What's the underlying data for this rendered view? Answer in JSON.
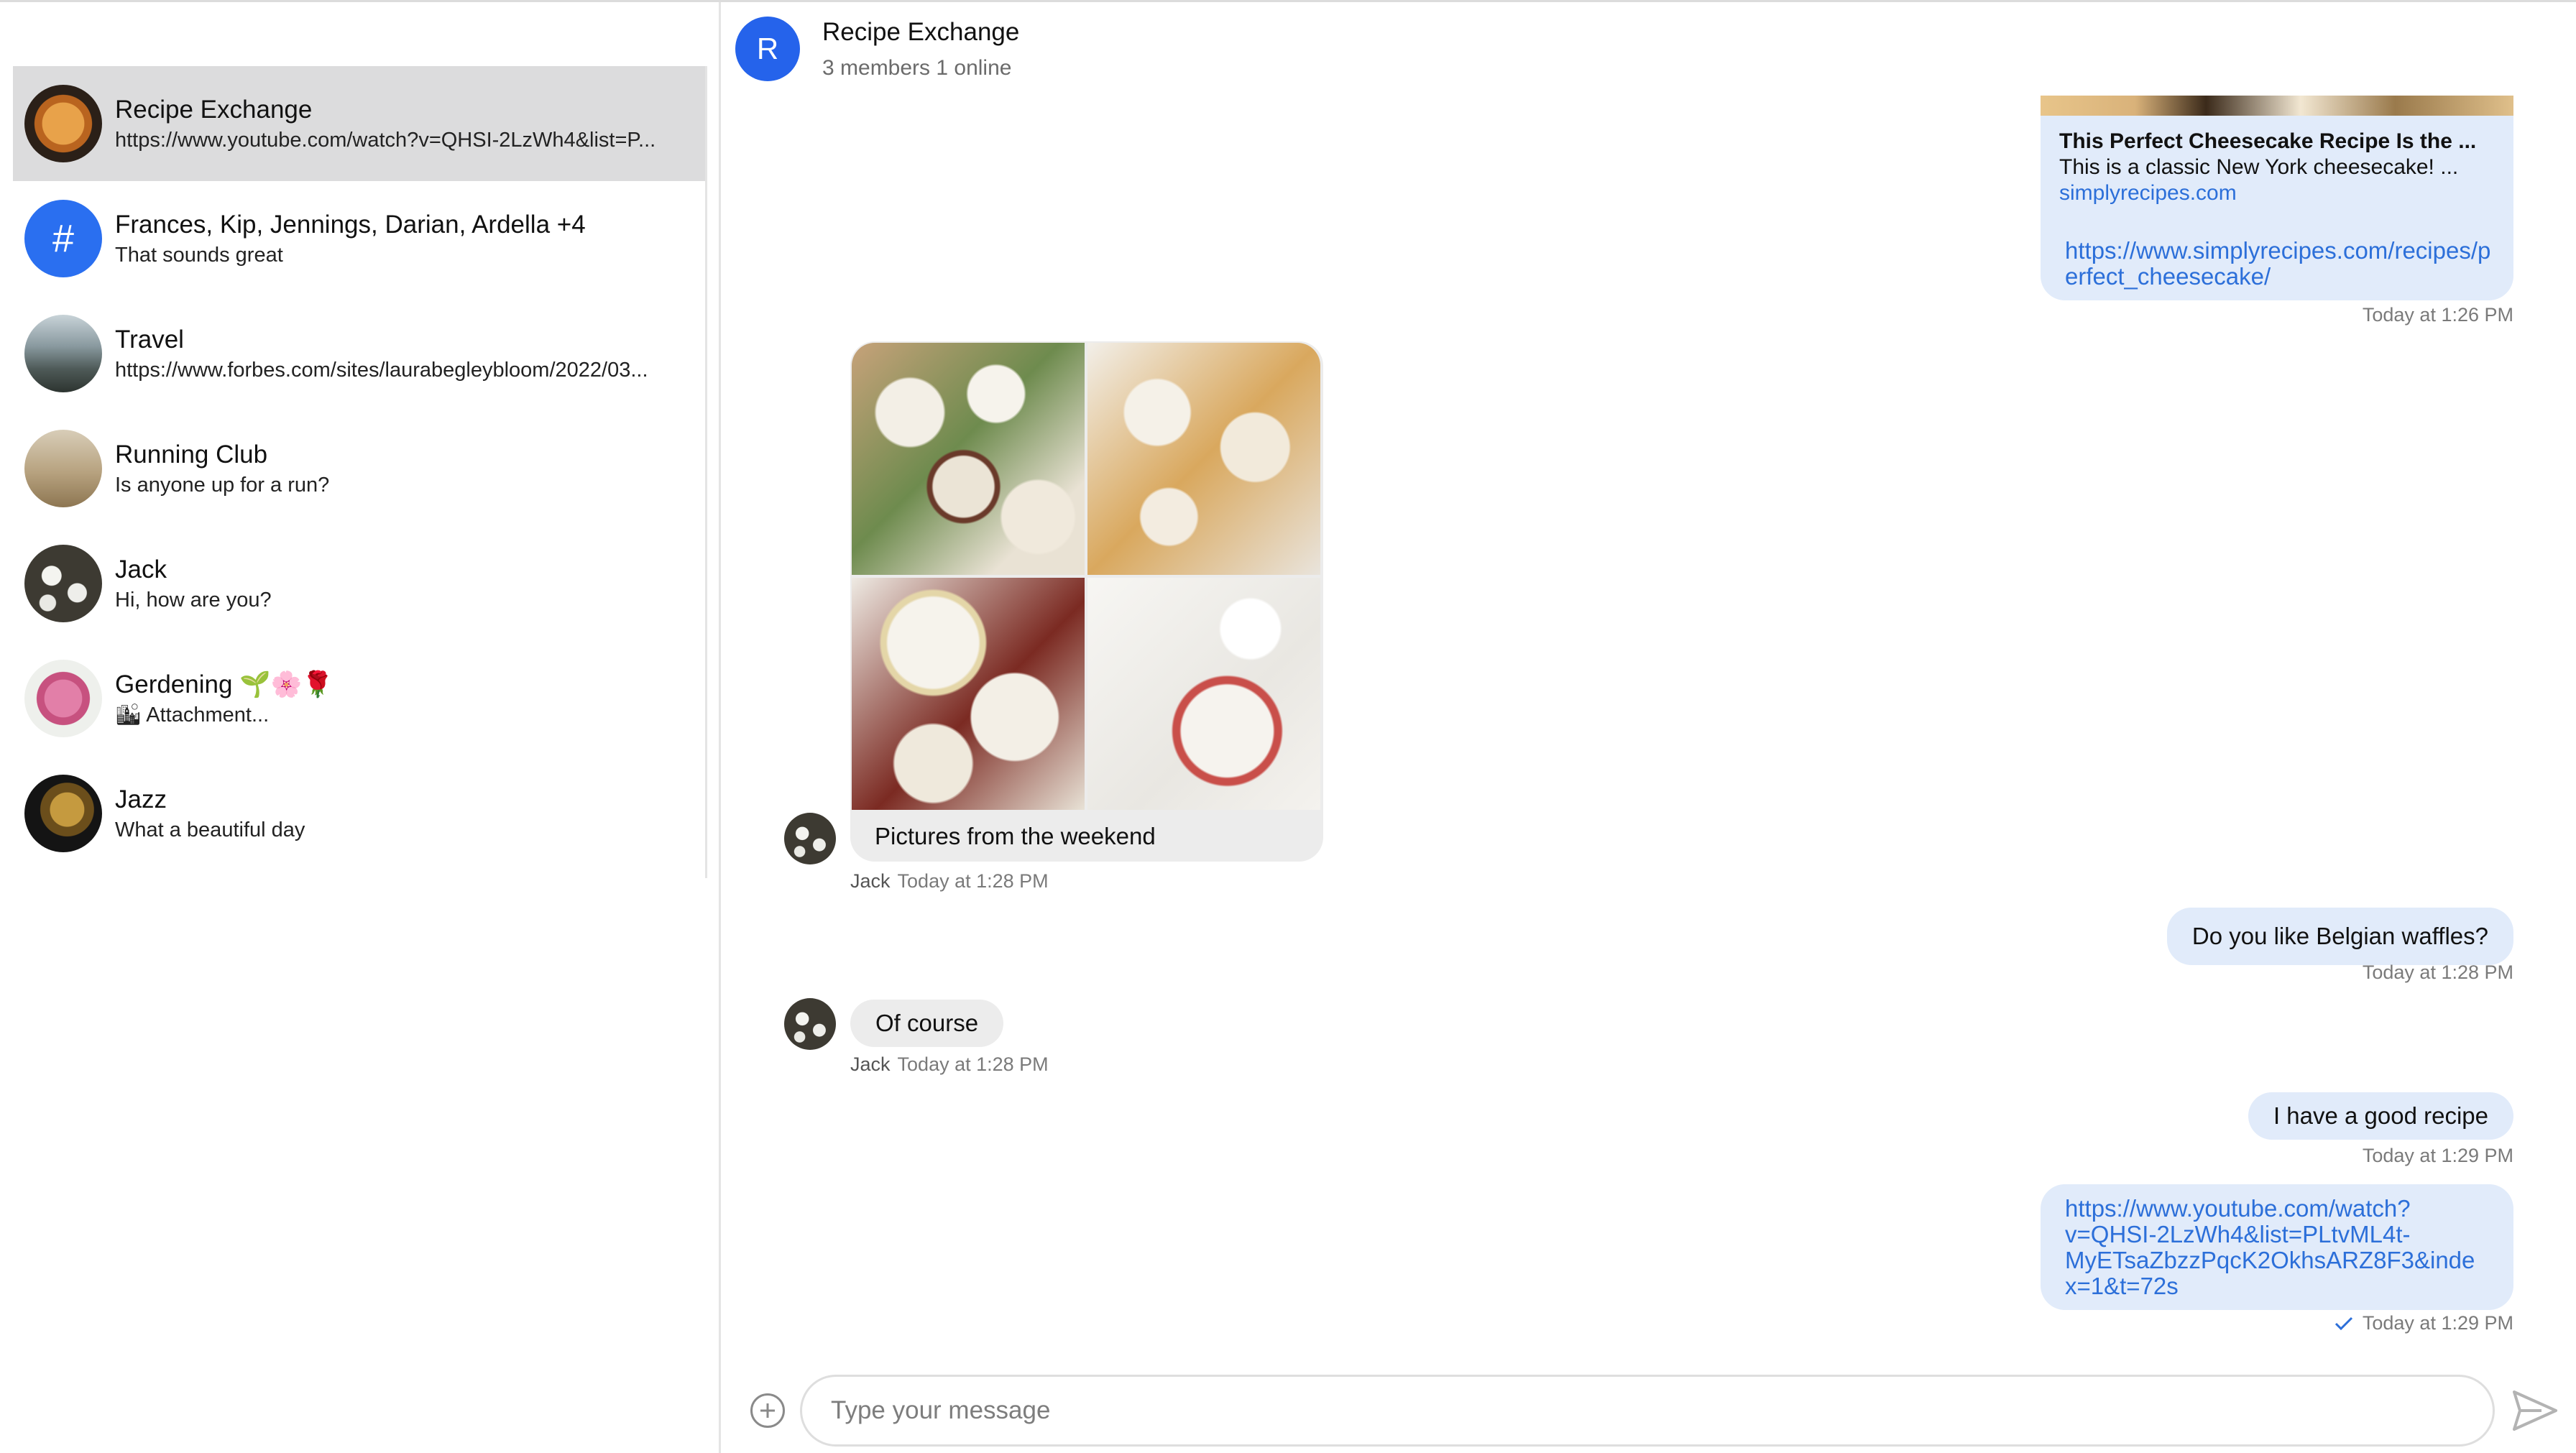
{
  "header": {
    "avatar_letter": "R",
    "title": "Recipe Exchange",
    "subtitle": "3 members 1 online"
  },
  "sidebar": {
    "channels": [
      {
        "name": "Recipe Exchange",
        "preview": "https://www.youtube.com/watch?v=QHSI-2LzWh4&list=P...",
        "avatar": "orange-dish"
      },
      {
        "name": "Frances, Kip, Jennings, Darian, Ardella +4",
        "preview": "That sounds great",
        "avatar": "hash",
        "avatar_glyph": "#"
      },
      {
        "name": "Travel",
        "preview": "https://www.forbes.com/sites/laurabegleybloom/2022/03...",
        "avatar": "mountains"
      },
      {
        "name": "Running Club",
        "preview": "Is anyone up for a run?",
        "avatar": "desert"
      },
      {
        "name": "Jack",
        "preview": "Hi, how are you?",
        "avatar": "white-flowers"
      },
      {
        "name": "Gerdening 🌱🌸🌹",
        "preview": "🏙 Attachment...",
        "avatar": "pink-flower"
      },
      {
        "name": "Jazz",
        "preview": "What a beautiful day",
        "avatar": "gramophone"
      }
    ]
  },
  "messages": {
    "link_preview": {
      "title": "This Perfect Cheesecake Recipe Is the ...",
      "description": "This is a classic New York cheesecake! ...",
      "site": "simplyrecipes.com",
      "url": "https://www.simplyrecipes.com/recipes/perfect_cheesecake/",
      "time": "Today at 1:26 PM"
    },
    "gallery": {
      "caption": "Pictures from the weekend",
      "author": "Jack",
      "time": "Today at 1:28 PM"
    },
    "waffles": {
      "text": "Do you like Belgian waffles?",
      "time": "Today at 1:28 PM"
    },
    "of_course": {
      "text": "Of course",
      "author": "Jack",
      "time": "Today at 1:28 PM"
    },
    "recipe": {
      "text": "I have a good recipe",
      "time": "Today at 1:29 PM"
    },
    "youtube": {
      "url": "https://www.youtube.com/watch?v=QHSI-2LzWh4&list=PLtvML4t-MyETsaZbzzPqcK2OkhsARZ8F3&index=1&t=72s",
      "url_lines": [
        "https://www.youtube.com/watch?",
        "v=QHSI-2LzWh4&list=PLtvML4t-",
        "MyETsaZbzzPqcK2OkhsARZ8F3&inde",
        "x=1&t=72s"
      ],
      "time": "Today at 1:29 PM",
      "status_icon": "check-icon"
    }
  },
  "composer": {
    "placeholder": "Type your message",
    "add_icon": "plus-circle-icon",
    "send_icon": "send-icon"
  },
  "colors": {
    "accent": "#2563eb",
    "own_bubble": "#e1ebfa",
    "other_bubble": "#ececec",
    "link": "#2c6fd9",
    "active_channel": "#dcdcdd"
  }
}
